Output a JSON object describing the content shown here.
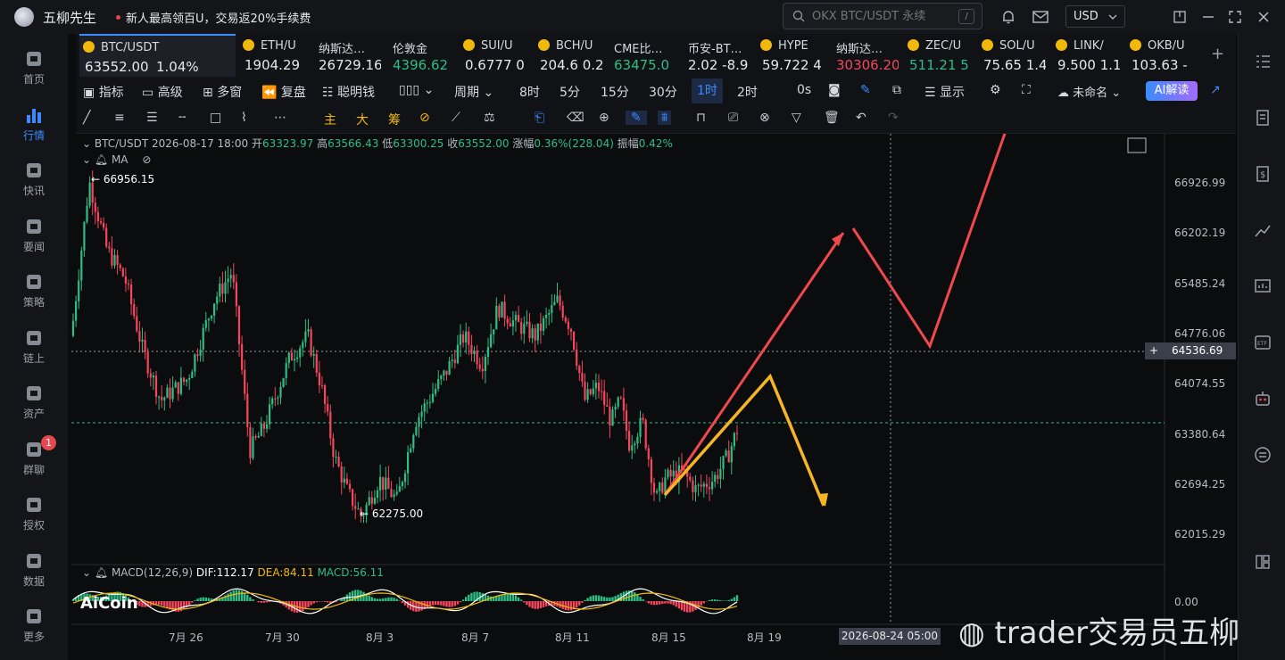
{
  "titlebar": {
    "app_title": "五柳先生",
    "promo": "新人最高领百U，交易返20%手续费",
    "search_placeholder": "OKX BTC/USDT 永续",
    "search_shortcut": "/",
    "currency": "USD"
  },
  "leftnav": [
    {
      "label": "首页",
      "icon": "home-icon"
    },
    {
      "label": "行情",
      "icon": "market-icon",
      "active": true
    },
    {
      "label": "快讯",
      "icon": "flash-news-icon"
    },
    {
      "label": "要闻",
      "icon": "news-icon"
    },
    {
      "label": "策略",
      "icon": "strategy-icon"
    },
    {
      "label": "链上",
      "icon": "onchain-icon"
    },
    {
      "label": "资产",
      "icon": "wallet-icon"
    },
    {
      "label": "群聊",
      "icon": "chat-icon",
      "badge": "1"
    },
    {
      "label": "授权",
      "icon": "auth-icon"
    },
    {
      "label": "数据",
      "icon": "data-icon"
    },
    {
      "label": "更多",
      "icon": "more-icon"
    }
  ],
  "tickers": [
    {
      "name": "BTC/USDT",
      "price": "63552.00",
      "change": "1.04%",
      "active": true
    },
    {
      "name": "ETH/U",
      "price": "1904.29"
    },
    {
      "name": "纳斯达…",
      "price": "26729.16"
    },
    {
      "name": "伦敦金",
      "price": "4396.62",
      "color": "green"
    },
    {
      "name": "SUI/U",
      "price": "0.6777 0"
    },
    {
      "name": "BCH/U",
      "price": "204.6 0.2"
    },
    {
      "name": "CME比…",
      "price": "63475.0",
      "color": "green"
    },
    {
      "name": "币安-BT…",
      "price": "2.02 -8.9"
    },
    {
      "name": "HYPE",
      "price": "59.722 4"
    },
    {
      "name": "纳斯达…",
      "price": "30306.20",
      "color": "red"
    },
    {
      "name": "ZEC/U",
      "price": "511.21 5",
      "color": "green"
    },
    {
      "name": "SOL/U",
      "price": "75.65 1.4"
    },
    {
      "name": "LINK/",
      "price": "9.500 1.1"
    },
    {
      "name": "OKB/U",
      "price": "103.63 -"
    }
  ],
  "toolbar1": {
    "indicators": "指标",
    "advanced": "高级",
    "multi_window": "多窗",
    "replay": "复盘",
    "smart_money": "聪明钱",
    "period": "周期",
    "timeframes": [
      "8时",
      "5分",
      "15分",
      "30分",
      "1时",
      "2时",
      "0s"
    ],
    "active_timeframe": "1时",
    "display": "显示",
    "unnamed": "未命名",
    "ai_read": "AI解读"
  },
  "toolbar2": {
    "main": "主",
    "big": "大",
    "chips": "筹"
  },
  "chart": {
    "symbol": "BTC/USDT",
    "datetime": "2026-08-17 18:00",
    "open_label": "开",
    "open": "63323.97",
    "high_label": "高",
    "high": "63566.43",
    "low_label": "低",
    "low": "63300.25",
    "close_label": "收",
    "close": "63552.00",
    "change_label": "涨幅",
    "change": "0.36%(228.04)",
    "amplitude_label": "振幅",
    "amplitude": "0.42%",
    "ma_label": "MA",
    "high_marker": "← 66956.15",
    "low_marker": "← 62275.00",
    "y_ticks": [
      "66926.99",
      "66202.19",
      "65485.24",
      "64776.06",
      "64074.55",
      "63380.64",
      "62694.25",
      "62015.29"
    ],
    "crosshair_price": "64536.69",
    "crosshair_time": "2026-08-24 05:00",
    "x_ticks": [
      "7月 26",
      "7月 30",
      "8月 3",
      "8月 7",
      "8月 11",
      "8月 15",
      "8月 19"
    ],
    "macd_label": "MACD(12,26,9)",
    "dif": "DIF:112.17",
    "dea": "DEA:84.11",
    "macd": "MACD:56.11",
    "macd_zero": "0.00",
    "brand": "AiCoin"
  },
  "watermark": "trader交易员五柳",
  "colors": {
    "up": "#2ebd85",
    "down": "#f6465d",
    "accent": "#3b8bff",
    "arrow_red": "#f0484d",
    "arrow_yellow": "#f5b524"
  }
}
